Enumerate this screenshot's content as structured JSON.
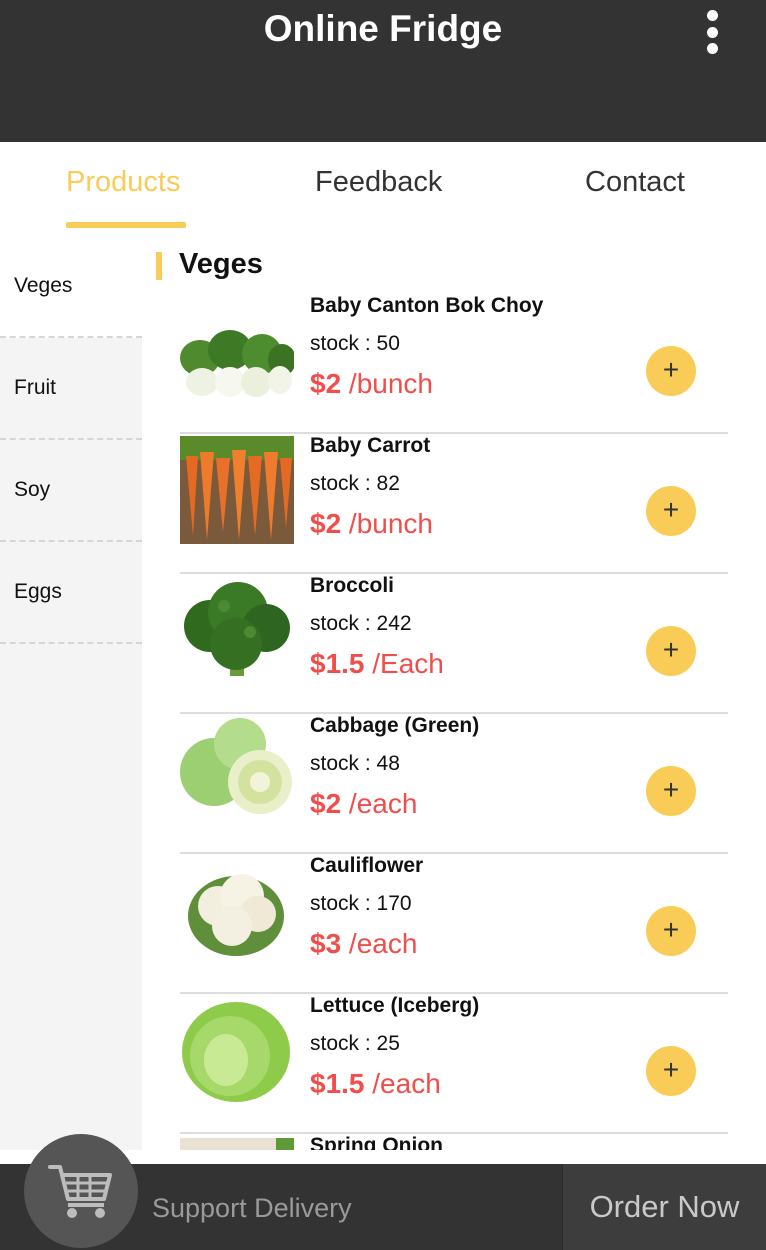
{
  "header": {
    "title": "Online Fridge"
  },
  "tabs": [
    {
      "label": "Products",
      "active": true
    },
    {
      "label": "Feedback",
      "active": false
    },
    {
      "label": "Contact",
      "active": false
    }
  ],
  "sidebar": {
    "items": [
      {
        "label": "Veges"
      },
      {
        "label": "Fruit"
      },
      {
        "label": "Soy"
      },
      {
        "label": "Eggs"
      }
    ]
  },
  "section": {
    "title": "Veges"
  },
  "products": [
    {
      "name": "Baby Canton Bok Choy",
      "stock": "stock : 50",
      "price": "$2",
      "unit": " /bunch",
      "image": "bok-choy"
    },
    {
      "name": "Baby Carrot",
      "stock": "stock : 82",
      "price": "$2",
      "unit": " /bunch",
      "image": "carrot"
    },
    {
      "name": "Broccoli",
      "stock": "stock : 242",
      "price": "$1.5",
      "unit": " /Each",
      "image": "broccoli"
    },
    {
      "name": "Cabbage (Green)",
      "stock": "stock : 48",
      "price": "$2",
      "unit": " /each",
      "image": "cabbage"
    },
    {
      "name": "Cauliflower",
      "stock": "stock : 170",
      "price": "$3",
      "unit": " /each",
      "image": "cauliflower"
    },
    {
      "name": "Lettuce (Iceberg)",
      "stock": "stock : 25",
      "price": "$1.5",
      "unit": " /each",
      "image": "lettuce"
    },
    {
      "name": "Spring Onion",
      "image": "spring-onion"
    }
  ],
  "add_symbol": "+",
  "bottom": {
    "support_label": "Support Delivery",
    "order_label": "Order Now",
    "cart_icon": "cart-icon"
  },
  "colors": {
    "header_bg": "#333333",
    "accent": "#f9cc57",
    "price": "#f04e4b",
    "sidebar_bg": "#f4f4f4"
  }
}
